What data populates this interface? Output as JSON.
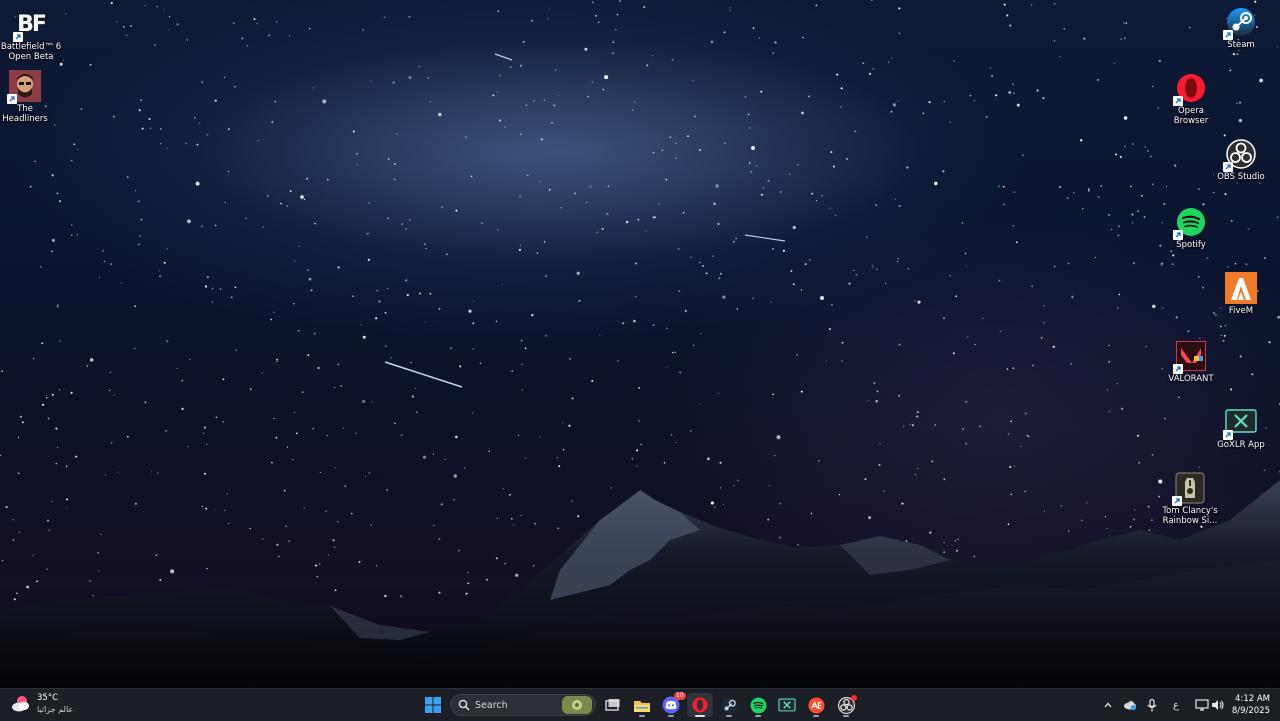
{
  "desktop": {
    "left_icons": [
      {
        "label": "Battlefield™ 6\nOpen Beta",
        "icon": "battlefield-icon"
      },
      {
        "label": "The\nHeadliners",
        "icon": "headliners-icon"
      }
    ],
    "right_icons": [
      {
        "label": "Steam",
        "icon": "steam-icon"
      },
      {
        "label": "Opera\nBrowser",
        "icon": "opera-icon"
      },
      {
        "label": "OBS Studio",
        "icon": "obs-icon"
      },
      {
        "label": "Spotify",
        "icon": "spotify-icon"
      },
      {
        "label": "FiveM",
        "icon": "fivem-icon"
      },
      {
        "label": "VALORANT",
        "icon": "valorant-icon"
      },
      {
        "label": "GoXLR App",
        "icon": "goxlr-icon"
      },
      {
        "label": "Tom Clancy's\nRainbow Si...",
        "icon": "rainbow-six-icon"
      }
    ],
    "battlefield_logo_text": "BF"
  },
  "taskbar": {
    "weather": {
      "temp": "35°C",
      "condition": "عالم جزائيا",
      "icon": "weather-icon"
    },
    "search_placeholder": "Search",
    "discord_badge": "10",
    "ime_indicator": "ع",
    "clock": {
      "time": "4:12 AM",
      "date": "8/9/2025"
    },
    "colors": {
      "taskbar_bg": "#1c1f26",
      "windows_blue": "#3aa0f2"
    }
  }
}
